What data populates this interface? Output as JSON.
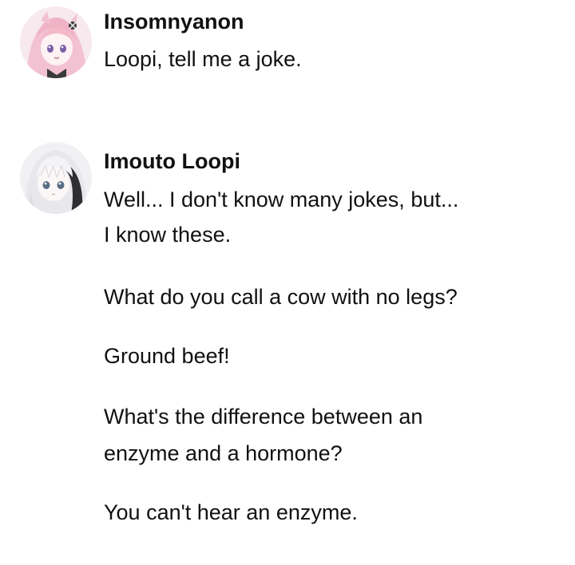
{
  "messages": [
    {
      "avatar_icon": "pink-anime-girl-avatar",
      "username": "Insomnyanon",
      "lines": [
        "Loopi, tell me a joke."
      ]
    },
    {
      "avatar_icon": "white-haired-anime-girl-avatar",
      "username": "Imouto Loopi",
      "lines": [
        "Well... I don't know many jokes, but...",
        "I know these.",
        "What do you call a cow with no legs?",
        "Ground beef!",
        "What's the difference between an",
        "enzyme and a hormone?",
        "You can't hear an enzyme."
      ]
    }
  ]
}
